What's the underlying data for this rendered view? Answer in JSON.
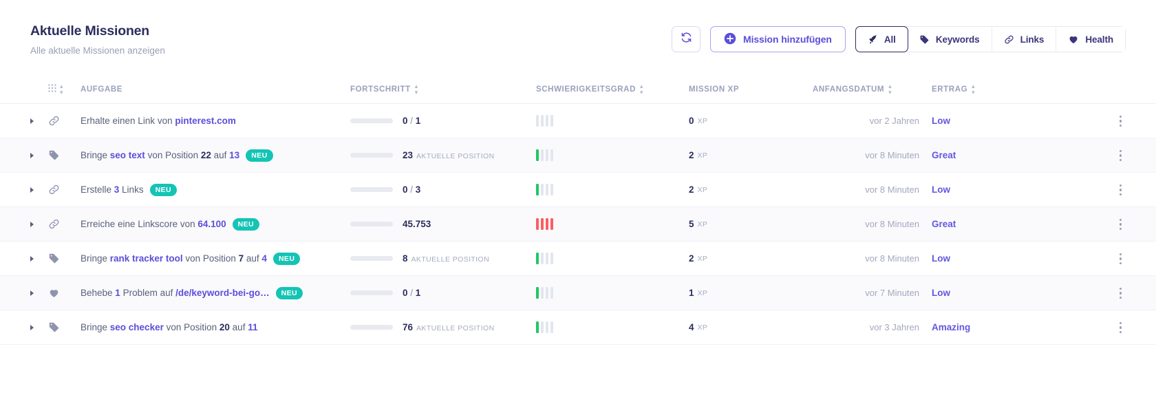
{
  "header": {
    "title": "Aktuelle Missionen",
    "subtitle": "Alle aktuelle Missionen anzeigen",
    "refresh_label": "",
    "add_mission_label": "Mission hinzufügen",
    "filters": [
      {
        "label": "All",
        "icon": "rocket-icon",
        "active": true
      },
      {
        "label": "Keywords",
        "icon": "tag-icon",
        "active": false
      },
      {
        "label": "Links",
        "icon": "link-icon",
        "active": false
      },
      {
        "label": "Health",
        "icon": "heart-icon",
        "active": false
      }
    ]
  },
  "table": {
    "columns": [
      {
        "key": "grid",
        "label": "",
        "sortable": true
      },
      {
        "key": "task",
        "label": "AUFGABE",
        "sortable": false
      },
      {
        "key": "progress",
        "label": "FORTSCHRITT",
        "sortable": true
      },
      {
        "key": "difficulty",
        "label": "SCHWIERIGKEITSGRAD",
        "sortable": true
      },
      {
        "key": "xp",
        "label": "MISSION XP",
        "sortable": false
      },
      {
        "key": "start_date",
        "label": "ANFANGSDATUM",
        "sortable": true
      },
      {
        "key": "yield",
        "label": "ERTRAG",
        "sortable": true
      }
    ],
    "new_badge_label": "NEU",
    "xp_unit": "XP",
    "position_unit": "AKTUELLE POSITION",
    "rows": [
      {
        "icon": "link-icon",
        "task_parts": [
          {
            "text": "Erhalte einen Link von ",
            "style": "normal"
          },
          {
            "text": "pinterest.com",
            "style": "accent"
          }
        ],
        "is_new": false,
        "progress_percent": 0,
        "progress_value": "0",
        "progress_total": "1",
        "progress_unit": "",
        "progress_style": "fraction",
        "difficulty_level": 0,
        "difficulty_color": "gray",
        "xp": "0",
        "start_date": "vor 2 Jahren",
        "yield": "Low"
      },
      {
        "icon": "tag-icon",
        "task_parts": [
          {
            "text": "Bringe ",
            "style": "normal"
          },
          {
            "text": "seo text",
            "style": "accent"
          },
          {
            "text": " von Position ",
            "style": "normal"
          },
          {
            "text": "22",
            "style": "bold"
          },
          {
            "text": " auf ",
            "style": "normal"
          },
          {
            "text": "13",
            "style": "accent"
          }
        ],
        "is_new": true,
        "progress_percent": 0,
        "progress_value": "23",
        "progress_total": "",
        "progress_unit": "AKTUELLE POSITION",
        "progress_style": "position",
        "difficulty_level": 1,
        "difficulty_color": "green",
        "xp": "2",
        "start_date": "vor 8 Minuten",
        "yield": "Great"
      },
      {
        "icon": "link-icon",
        "task_parts": [
          {
            "text": "Erstelle ",
            "style": "normal"
          },
          {
            "text": "3",
            "style": "accent"
          },
          {
            "text": " Links",
            "style": "normal"
          }
        ],
        "is_new": true,
        "progress_percent": 0,
        "progress_value": "0",
        "progress_total": "3",
        "progress_unit": "",
        "progress_style": "fraction",
        "difficulty_level": 1,
        "difficulty_color": "green",
        "xp": "2",
        "start_date": "vor 8 Minuten",
        "yield": "Low"
      },
      {
        "icon": "link-icon",
        "task_parts": [
          {
            "text": "Erreiche eine Linkscore von ",
            "style": "normal"
          },
          {
            "text": "64.100",
            "style": "accent"
          }
        ],
        "is_new": true,
        "progress_percent": 0,
        "progress_value": "45.753",
        "progress_total": "",
        "progress_unit": "",
        "progress_style": "single",
        "difficulty_level": 4,
        "difficulty_color": "red",
        "xp": "5",
        "start_date": "vor 8 Minuten",
        "yield": "Great"
      },
      {
        "icon": "tag-icon",
        "task_parts": [
          {
            "text": "Bringe ",
            "style": "normal"
          },
          {
            "text": "rank tracker tool",
            "style": "accent"
          },
          {
            "text": " von Position ",
            "style": "normal"
          },
          {
            "text": "7",
            "style": "bold"
          },
          {
            "text": " auf ",
            "style": "normal"
          },
          {
            "text": "4",
            "style": "accent"
          }
        ],
        "is_new": true,
        "progress_percent": 0,
        "progress_value": "8",
        "progress_total": "",
        "progress_unit": "AKTUELLE POSITION",
        "progress_style": "position",
        "difficulty_level": 1,
        "difficulty_color": "green",
        "xp": "2",
        "start_date": "vor 8 Minuten",
        "yield": "Low"
      },
      {
        "icon": "heart-icon",
        "task_parts": [
          {
            "text": "Behebe ",
            "style": "normal"
          },
          {
            "text": "1",
            "style": "accent"
          },
          {
            "text": " Problem auf ",
            "style": "normal"
          },
          {
            "text": "/de/keyword-bei-go…",
            "style": "accent"
          }
        ],
        "is_new": true,
        "progress_percent": 0,
        "progress_value": "0",
        "progress_total": "1",
        "progress_unit": "",
        "progress_style": "fraction",
        "difficulty_level": 1,
        "difficulty_color": "green",
        "xp": "1",
        "start_date": "vor 7 Minuten",
        "yield": "Low"
      },
      {
        "icon": "tag-icon",
        "task_parts": [
          {
            "text": "Bringe ",
            "style": "normal"
          },
          {
            "text": "seo checker",
            "style": "accent"
          },
          {
            "text": " von Position ",
            "style": "normal"
          },
          {
            "text": "20",
            "style": "bold"
          },
          {
            "text": " auf ",
            "style": "normal"
          },
          {
            "text": "11",
            "style": "accent"
          }
        ],
        "is_new": false,
        "progress_percent": 0,
        "progress_value": "76",
        "progress_total": "",
        "progress_unit": "AKTUELLE POSITION",
        "progress_style": "position",
        "difficulty_level": 1,
        "difficulty_color": "green",
        "xp": "4",
        "start_date": "vor 3 Jahren",
        "yield": "Amazing"
      }
    ]
  },
  "colors": {
    "accent": "#5b4ddb",
    "title": "#2b2d5c",
    "muted": "#9ba0b5",
    "badge": "#14c4b4",
    "difficulty_green": "#22c763",
    "difficulty_red": "#fb5f63",
    "difficulty_empty": "#e3e6ee"
  }
}
